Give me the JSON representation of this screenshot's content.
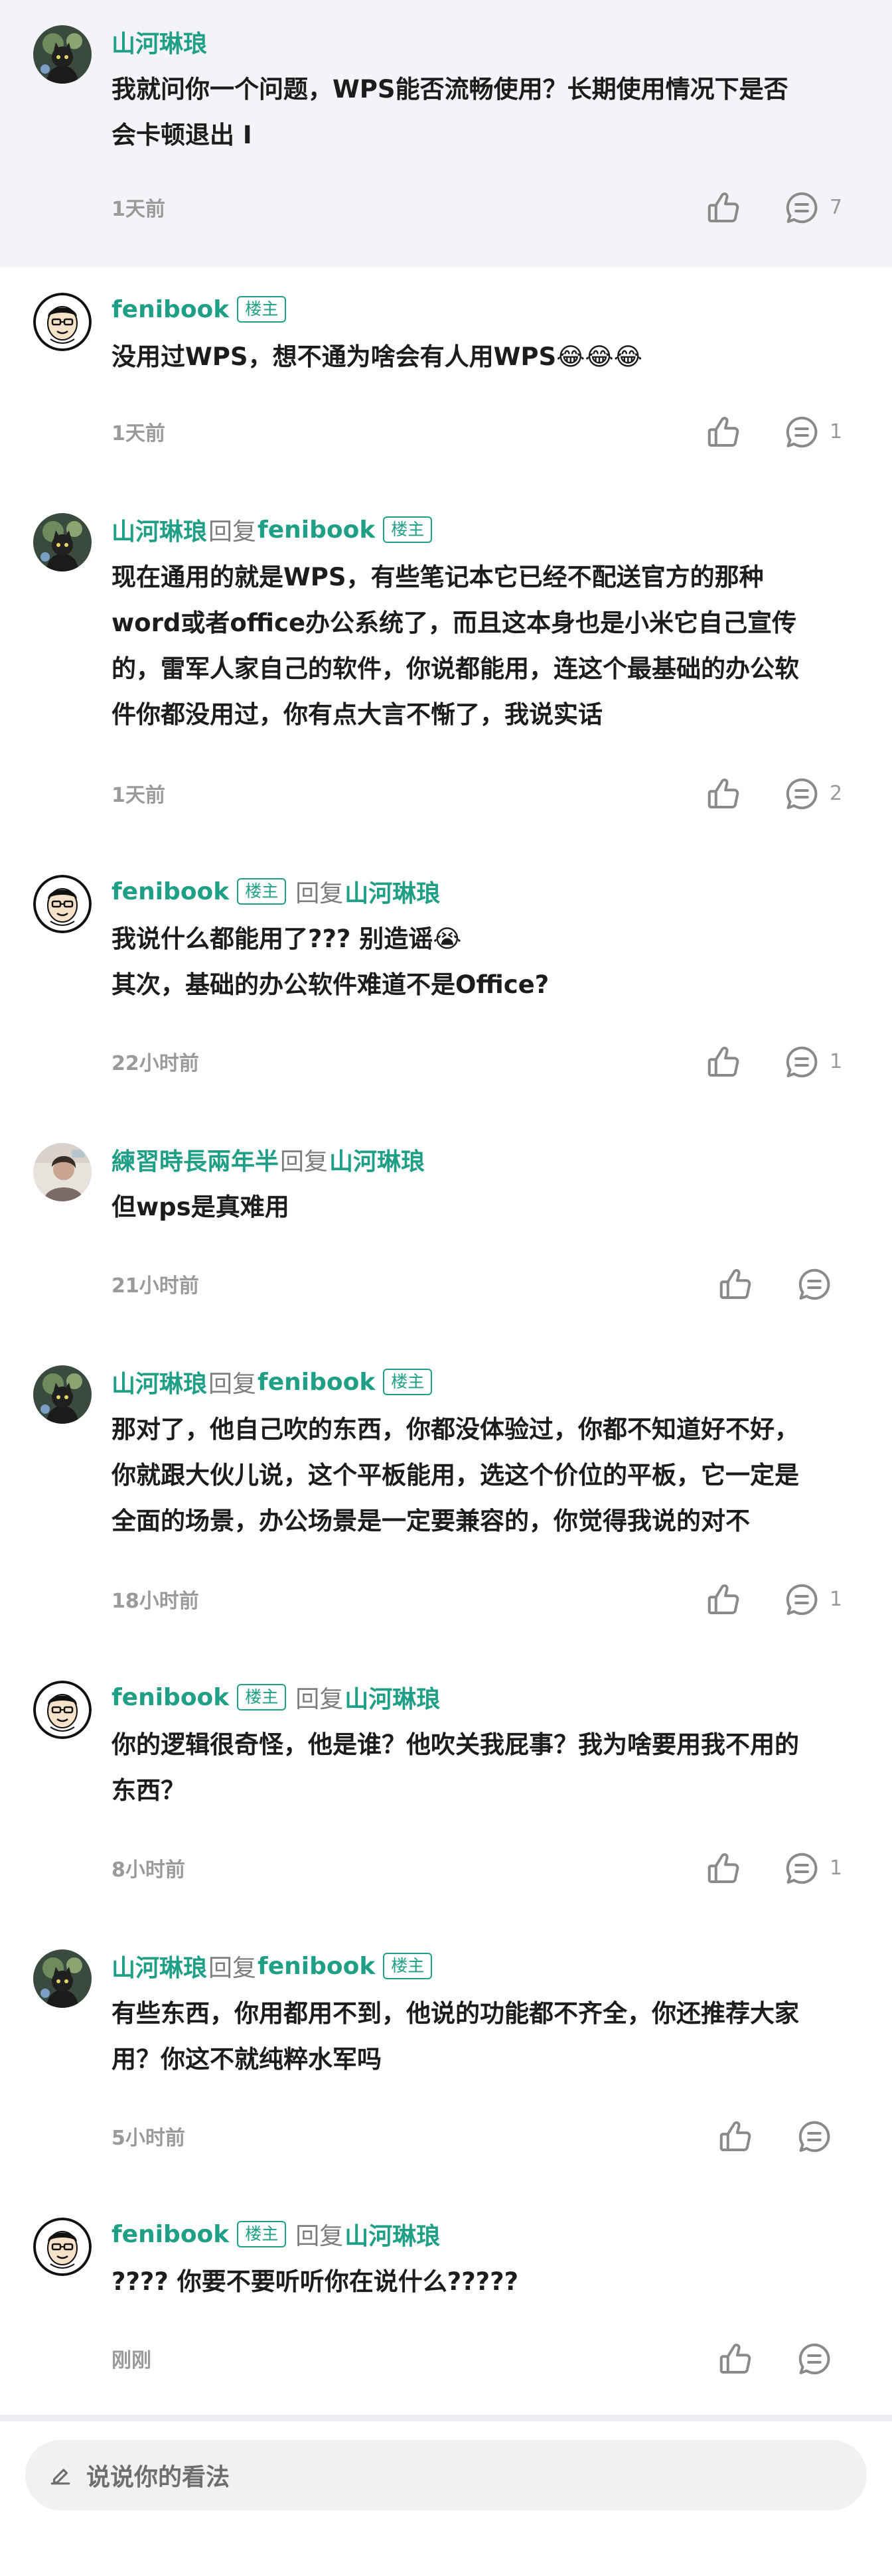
{
  "comments": [
    {
      "user": "山河琳琅",
      "user_badge": "",
      "reply_label": "",
      "reply_to": "",
      "reply_to_badge": "",
      "lines": [
        "我就问你一个问题，WPS能否流畅使用？长期使用情况下是否",
        "会卡顿退出 I"
      ],
      "time": "1天前",
      "reply_count": "7",
      "avatar": "cat-avatar"
    },
    {
      "user": "fenibook",
      "user_badge": "楼主",
      "reply_label": "",
      "reply_to": "",
      "reply_to_badge": "",
      "lines": [
        "没用过WPS，想不通为啥会有人用WPS😂😂😂"
      ],
      "time": "1天前",
      "reply_count": "1",
      "avatar": "cartoon-face-avatar"
    },
    {
      "user": "山河琳琅",
      "user_badge": "",
      "reply_label": "回复",
      "reply_to": "fenibook",
      "reply_to_badge": "楼主",
      "lines": [
        "现在通用的就是WPS，有些笔记本它已经不配送官方的那种",
        "word或者office办公系统了，而且这本身也是小米它自己宣传",
        "的，雷军人家自己的软件，你说都能用，连这个最基础的办公软",
        "件你都没用过，你有点大言不惭了，我说实话"
      ],
      "time": "1天前",
      "reply_count": "2",
      "avatar": "cat-avatar"
    },
    {
      "user": "fenibook",
      "user_badge": "楼主",
      "reply_label": "回复",
      "reply_to": "山河琳琅",
      "reply_to_badge": "",
      "lines": [
        "我说什么都能用了???  别造谣😭",
        "其次，基础的办公软件难道不是Office?"
      ],
      "time": "22小时前",
      "reply_count": "1",
      "avatar": "cartoon-face-avatar"
    },
    {
      "user": "練習時長兩年半",
      "user_badge": "",
      "reply_label": "回复",
      "reply_to": "山河琳琅",
      "reply_to_badge": "",
      "lines": [
        "但wps是真难用"
      ],
      "time": "21小时前",
      "reply_count": "",
      "avatar": "person-avatar"
    },
    {
      "user": "山河琳琅",
      "user_badge": "",
      "reply_label": "回复",
      "reply_to": "fenibook",
      "reply_to_badge": "楼主",
      "lines": [
        "那对了，他自己吹的东西，你都没体验过，你都不知道好不好，",
        "你就跟大伙儿说，这个平板能用，选这个价位的平板，它一定是",
        "全面的场景，办公场景是一定要兼容的，你觉得我说的对不"
      ],
      "time": "18小时前",
      "reply_count": "1",
      "avatar": "cat-avatar"
    },
    {
      "user": "fenibook",
      "user_badge": "楼主",
      "reply_label": "回复",
      "reply_to": "山河琳琅",
      "reply_to_badge": "",
      "lines": [
        "你的逻辑很奇怪，他是谁？他吹关我屁事？我为啥要用我不用的",
        "东西？"
      ],
      "time": "8小时前",
      "reply_count": "1",
      "avatar": "cartoon-face-avatar"
    },
    {
      "user": "山河琳琅",
      "user_badge": "",
      "reply_label": "回复",
      "reply_to": "fenibook",
      "reply_to_badge": "楼主",
      "lines": [
        "有些东西，你用都用不到，他说的功能都不齐全，你还推荐大家",
        "用？你这不就纯粹水军吗"
      ],
      "time": "5小时前",
      "reply_count": "",
      "avatar": "cat-avatar"
    },
    {
      "user": "fenibook",
      "user_badge": "楼主",
      "reply_label": "回复",
      "reply_to": "山河琳琅",
      "reply_to_badge": "",
      "lines": [
        "????  你要不要听听你在说什么?????"
      ],
      "time": "刚刚",
      "reply_count": "",
      "avatar": "cartoon-face-avatar"
    }
  ],
  "input": {
    "placeholder": "说说你的看法",
    "icon": "pencil-icon"
  },
  "colors": {
    "accent": "#1f9f86",
    "meta": "#9a9a9a",
    "highlight_bg": "#f3f3f8"
  }
}
